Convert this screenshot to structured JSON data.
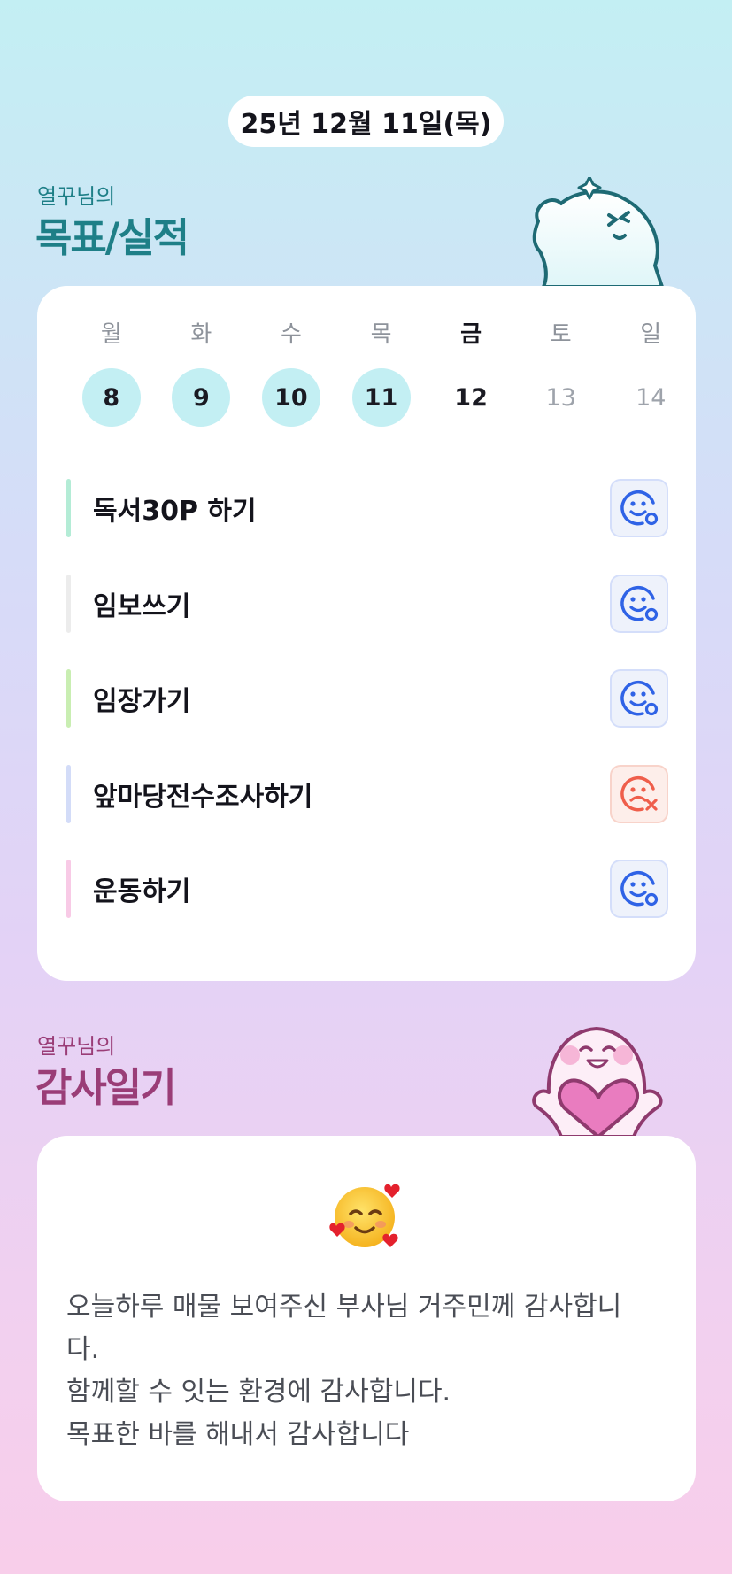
{
  "header": {
    "date": "25년 12월 11일(목)"
  },
  "goals_section": {
    "subtitle": "열꾸님의",
    "title": "목표/실적",
    "week": [
      {
        "name": "월",
        "date": "8",
        "state": "done"
      },
      {
        "name": "화",
        "date": "9",
        "state": "done"
      },
      {
        "name": "수",
        "date": "10",
        "state": "done"
      },
      {
        "name": "목",
        "date": "11",
        "state": "done"
      },
      {
        "name": "금",
        "date": "12",
        "state": "today"
      },
      {
        "name": "토",
        "date": "13",
        "state": "future"
      },
      {
        "name": "일",
        "date": "14",
        "state": "future"
      }
    ],
    "goals": [
      {
        "text": "독서30P 하기",
        "color": "#b4ecd6",
        "status": "achieved",
        "icon": "smile-check-icon"
      },
      {
        "text": "임보쓰기",
        "color": "#ececec",
        "status": "achieved",
        "icon": "smile-check-icon"
      },
      {
        "text": "임장가기",
        "color": "#c9eeb2",
        "status": "achieved",
        "icon": "smile-check-icon"
      },
      {
        "text": "앞마당전수조사하기",
        "color": "#d3dcf8",
        "status": "missed",
        "icon": "sad-x-icon"
      },
      {
        "text": "운동하기",
        "color": "#f8cae6",
        "status": "achieved",
        "icon": "smile-check-icon"
      }
    ],
    "colors": {
      "achieved": "#2f63e6",
      "missed": "#ef5e4b",
      "done_day_bg": "#c3eff3"
    }
  },
  "gratitude_section": {
    "subtitle": "열꾸님의",
    "title": "감사일기",
    "emoji": "smiling-face-with-hearts-icon",
    "entry": "오늘하루 매물 보여주신 부사님 거주민께 감사합니\n다.\n함께할 수 잇는 환경에 감사합니다.\n목표한 바를 해내서 감사합니다"
  }
}
